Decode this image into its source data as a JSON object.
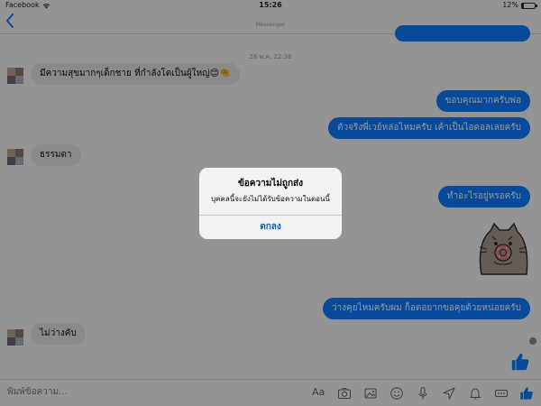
{
  "status_bar": {
    "carrier": "Facebook",
    "time": "15:26",
    "battery_text": "12%",
    "battery_level": 0.12
  },
  "nav": {
    "back_icon": "chevron-left-icon",
    "title": "",
    "subtitle": "Messenger"
  },
  "chat": {
    "timestamp": "28 พ.ค. 22:38",
    "messages": [
      {
        "dir": "in",
        "text": "มีความสุขมากๆเด็กชาย ที่กำลังโตเป็นผู้ใหญ่😊🤏"
      },
      {
        "dir": "out",
        "text": "ขอบคุณมากครับพ่อ"
      },
      {
        "dir": "out",
        "text": "ตัวจริงพี่เวย์หล่อไหมครับ เค้าเป็นไอดอลเลยครับ"
      },
      {
        "dir": "in",
        "text": "ธรรมดา"
      },
      {
        "dir": "out",
        "text": "ทำอะไรอยู่หรอครับ"
      },
      {
        "dir": "out",
        "text": "ว่างคุยไหมครับผม ก็อตอยากขอคุยด้วยหน่อยครับ"
      },
      {
        "dir": "in",
        "text": "ไม่ว่างคับ"
      }
    ],
    "sticker": "pusheen-cat-eating-donut-sticker"
  },
  "composer": {
    "placeholder": "พิมพ์ข้อความ...",
    "aa_label": "Aa",
    "tools": [
      "camera-icon",
      "gallery-icon",
      "emoji-icon",
      "microphone-icon",
      "location-icon",
      "bell-icon",
      "more-icon",
      "like-icon"
    ]
  },
  "alert": {
    "title": "ข้อความไม่ถูกส่ง",
    "message": "บุคคลนี้จะยังไม่ได้รับข้อความในตอนนี้",
    "ok_label": "ตกลง"
  },
  "colors": {
    "accent": "#0a7cff",
    "incoming": "#e7e7e9"
  }
}
